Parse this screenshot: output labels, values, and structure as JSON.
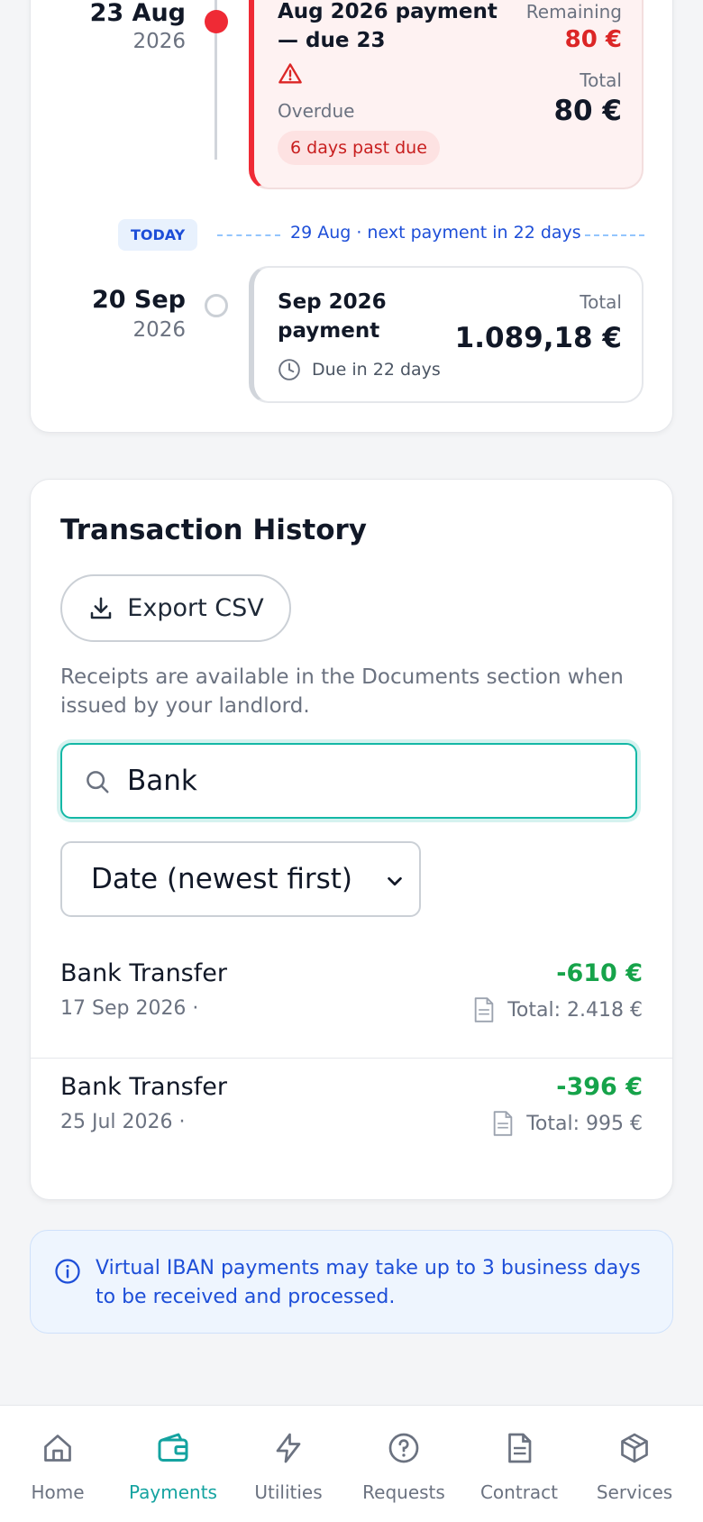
{
  "timeline": {
    "overdue_entry": {
      "date_day": "23 Aug",
      "date_year": "2026",
      "title": "Aug 2026 payment — due 23",
      "remaining_label": "Remaining",
      "remaining_amount": "80 €",
      "total_label": "Total",
      "total_amount": "80 €",
      "status_label": "Overdue",
      "past_due_badge": "6 days past due"
    },
    "today": {
      "badge": "TODAY",
      "text": "29 Aug · next payment in 22 days"
    },
    "upcoming_entry": {
      "date_day": "20 Sep",
      "date_year": "2026",
      "title_line1": "Sep 2026",
      "title_line2": "payment",
      "total_label": "Total",
      "total_amount": "1.089,18 €",
      "due_text": "Due in 22 days"
    }
  },
  "history": {
    "title": "Transaction History",
    "export_label": "Export CSV",
    "receipts_note": "Receipts are available in the Documents section when issued by your landlord.",
    "search_value": "Bank",
    "sort_selected": "Date (newest first)",
    "transactions": [
      {
        "name": "Bank Transfer",
        "date": "17 Sep 2026 ·",
        "amount": "-610 €",
        "total": "Total: 2.418 €"
      },
      {
        "name": "Bank Transfer",
        "date": "25 Jul 2026 ·",
        "amount": "-396 €",
        "total": "Total: 995 €"
      }
    ]
  },
  "info_banner": {
    "text": "Virtual IBAN payments may take up to 3 business days to be received and processed."
  },
  "nav": {
    "items": [
      {
        "label": "Home",
        "icon": "home-icon",
        "active": false
      },
      {
        "label": "Payments",
        "icon": "wallet-icon",
        "active": true
      },
      {
        "label": "Utilities",
        "icon": "lightning-icon",
        "active": false
      },
      {
        "label": "Requests",
        "icon": "question-icon",
        "active": false
      },
      {
        "label": "Contract",
        "icon": "document-icon",
        "active": false
      },
      {
        "label": "Services",
        "icon": "box-icon",
        "active": false
      }
    ]
  },
  "colors": {
    "accent": "#14a3a0",
    "overdue": "#ef2a35",
    "positive": "#16a34a",
    "info": "#1d4ed8"
  }
}
